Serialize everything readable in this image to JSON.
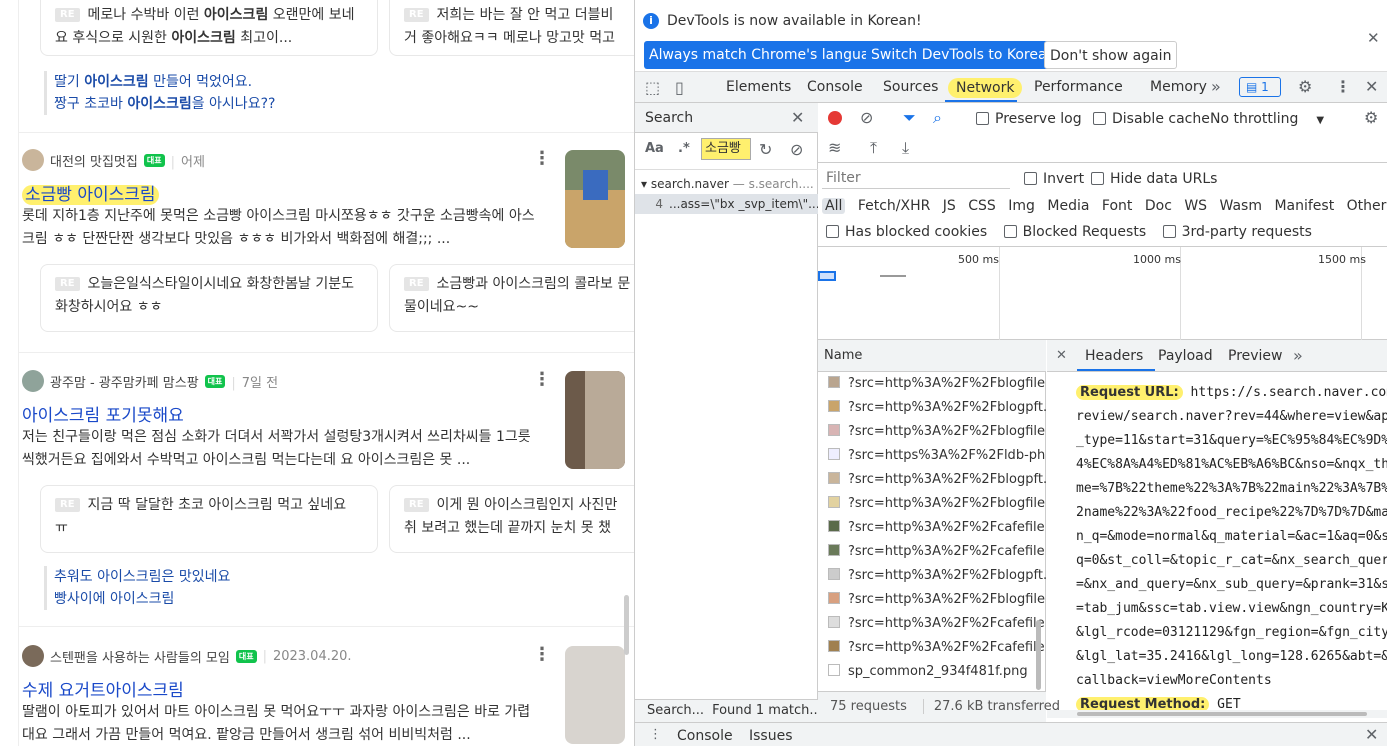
{
  "left": {
    "top_replies": [
      {
        "text_pre": "메로나 수박바 이런 ",
        "bold": "아이스크림",
        "text_post": " 오랜만에 보네요 후식으로 시원한 ",
        "bold2": "아이스크림",
        "text_end": " 최고이..."
      },
      {
        "text_pre": "저희는 바는 잘 안 먹고 더블비",
        "text_end": "거 좋아해요ㅋㅋ 메로나 망고맛 먹고"
      }
    ],
    "top_links": {
      "l1_pre": "딸기 ",
      "l1_bold": "아이스크림",
      "l1_post": " 만들어 먹었어요.",
      "l2_pre": "짱구 초코바 ",
      "l2_bold": "아이스크림",
      "l2_post": "을 아시나요??"
    },
    "re_label": "RE",
    "badge": "대표",
    "posts": [
      {
        "author": "대전의 맛집멋집",
        "date": "어제",
        "title_pre": "소금빵 ",
        "title_bold": "아이스크림",
        "desc": "롯데 지하1층 지난주에 못먹은 소금빵 아이스크림 마시쪼용ㅎㅎ 갓구운 소금빵속에 아스크림 ㅎㅎ 단짠단짠 생각보다 맛있음 ㅎㅎㅎ 비가와서 백화점에 해결;;; ...",
        "reply1": "오늘은일식스타일이시네요 화창한봄날 기분도화창하시어요 ㅎㅎ",
        "reply2": "소금빵과 아이스크림의 콜라보 문물이네요~~"
      },
      {
        "author": "광주맘 - 광주맘카페 맘스팡",
        "date": "7일 전",
        "title": "아이스크림 포기못해요",
        "desc": "저는 친구들이랑 먹은 점심 소화가 더뎌서 서꽉가서 설렁탕3개시켜서 쓰리차씨들 1그릇씩했거든요 집에와서 수박먹고 아이스크림 먹는다는데 요 아이스크림은 못 ...",
        "reply1": "지금 딱 달달한 초코 아이스크림 먹고 싶네요 ㅠ",
        "reply2": "이게 뭔 아이스크림인지 사진만 취 보려고 했는데 끝까지 눈치 못 챘",
        "link1": "추워도 아이스크림은 맛있네요",
        "link2": "빵사이에 아이스크림"
      },
      {
        "author": "스텐팬을 사용하는 사람들의 모임",
        "date": "2023.04.20.",
        "title_pre": "수제 요거트",
        "title_bold": "아이스크림",
        "desc": "딸램이 아토피가 있어서 마트 아이스크림 못 먹어요ㅜㅜ 과자랑 아이스크림은 바로 가렵대요 그래서 가끔 만들어 먹여요. 팥앙금 만들어서 생크림 섞어 비비빅처럼 ..."
      }
    ]
  },
  "devtools": {
    "infobar": {
      "text": "DevTools is now available in Korean!",
      "btn1": "Always match Chrome's language",
      "btn2": "Switch DevTools to Korean",
      "btn3": "Don't show again"
    },
    "tabs": [
      "Elements",
      "Console",
      "Sources",
      "Network",
      "Performance",
      "Memory"
    ],
    "active_tab": "Network",
    "issues_count": "1",
    "search": {
      "title": "Search",
      "aa": "Aa",
      "regex": ".*",
      "query": "소금빵",
      "result_file": "search.naver",
      "result_url": "s.search....",
      "line_no": "4",
      "line_text": "...ass=\\\"bx _svp_item\\\"...",
      "status_left": "Search...",
      "status_right": "Found 1 match..."
    },
    "network": {
      "preserve_log": "Preserve log",
      "disable_cache": "Disable cache",
      "throttle": "No throttling",
      "filter_placeholder": "Filter",
      "invert": "Invert",
      "hide_data": "Hide data URLs",
      "types": [
        "All",
        "Fetch/XHR",
        "JS",
        "CSS",
        "Img",
        "Media",
        "Font",
        "Doc",
        "WS",
        "Wasm",
        "Manifest",
        "Other"
      ],
      "blocked_cookies": "Has blocked cookies",
      "blocked_requests": "Blocked Requests",
      "third_party": "3rd-party requests",
      "timeline": [
        "500 ms",
        "1000 ms",
        "1500 ms"
      ],
      "name_header": "Name",
      "rows": [
        "?src=http%3A%2F%2Fblogfile...",
        "?src=http%3A%2F%2Fblogpft...",
        "?src=http%3A%2F%2Fblogfile...",
        "?src=https%3A%2F%2Fldb-ph...",
        "?src=http%3A%2F%2Fblogpft...",
        "?src=http%3A%2F%2Fblogfile...",
        "?src=http%3A%2F%2Fcafefile...",
        "?src=http%3A%2F%2Fcafefile...",
        "?src=http%3A%2F%2Fblogpft...",
        "?src=http%3A%2F%2Fblogfile...",
        "?src=http%3A%2F%2Fcafefile...",
        "?src=http%3A%2F%2Fcafefile...",
        "sp_common2_934f481f.png"
      ],
      "requests": "75 requests",
      "transferred": "27.6 kB transferred"
    },
    "detail": {
      "tabs": [
        "Headers",
        "Payload",
        "Preview"
      ],
      "url_key": "Request URL:",
      "url_lines": [
        " https://s.search.naver.com/p/",
        "review/search.naver?rev=44&where=view&api",
        "_type=11&start=31&query=%EC%95%84%EC%9D%B",
        "4%EC%8A%A4%ED%81%AC%EB%A6%BC&nso=&nqx_the",
        "me=%7B%22theme%22%3A%7B%22main%22%3A%7B%2",
        "2name%22%3A%22food_recipe%22%7D%7D%7D&mai",
        "n_q=&mode=normal&q_material=&ac=1&aq=0&sp",
        "q=0&st_coll=&topic_r_cat=&nx_search_query",
        "=&nx_and_query=&nx_sub_query=&prank=31&sm",
        "=tab_jum&ssc=tab.view.view&ngn_country=KR",
        "&lgl_rcode=03121129&fgn_region=&fgn_city=",
        "&lgl_lat=35.2416&lgl_long=128.6265&abt=&_",
        "callback=viewMoreContents"
      ],
      "method_key": "Request Method:",
      "method_val": " GET"
    },
    "drawer": {
      "console": "Console",
      "issues": "Issues"
    }
  }
}
